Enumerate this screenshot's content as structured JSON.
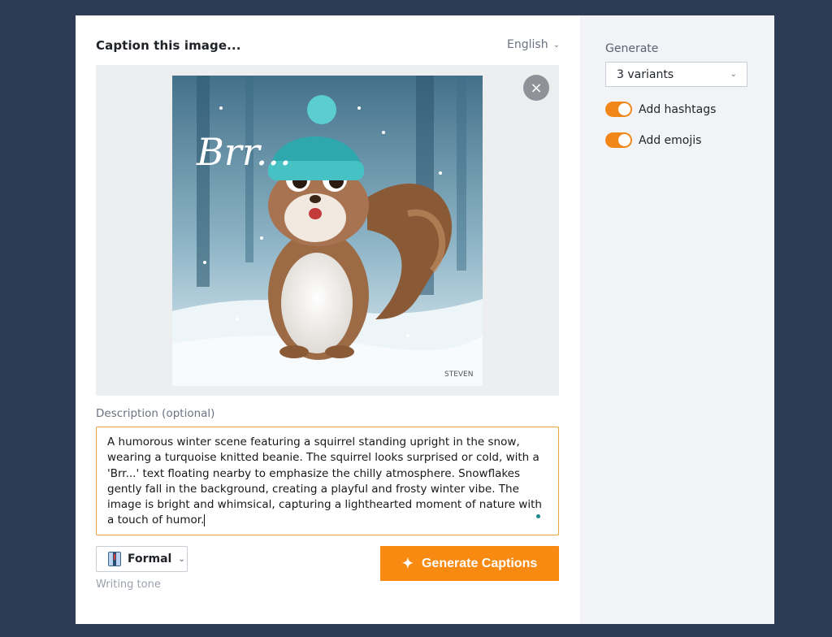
{
  "header": {
    "title": "Caption this image...",
    "language": "English"
  },
  "image": {
    "close_glyph": "×",
    "text_on_image": "Brr...",
    "signature": "STEVEN"
  },
  "description": {
    "label": "Description (optional)",
    "value": "A humorous winter scene featuring a squirrel standing upright in the snow, wearing a turquoise knitted beanie. The squirrel looks surprised or cold, with a 'Brr...' text floating nearby to emphasize the chilly atmosphere. Snowflakes gently fall in the background, creating a playful and frosty winter vibe. The image is bright and whimsical, capturing a lighthearted moment of nature with a touch of humor."
  },
  "tone": {
    "selected": "Formal",
    "caption": "Writing tone",
    "icon": "necktie-icon"
  },
  "actions": {
    "generate_label": "Generate Captions",
    "generate_icon": "sparkles-icon"
  },
  "settings": {
    "generate_label": "Generate",
    "variants": "3 variants",
    "toggles": [
      {
        "label": "Add hashtags",
        "on": true
      },
      {
        "label": "Add emojis",
        "on": true
      }
    ]
  },
  "colors": {
    "accent": "#f88a12",
    "background": "#2e3b55",
    "side_panel": "#f1f3f6"
  }
}
